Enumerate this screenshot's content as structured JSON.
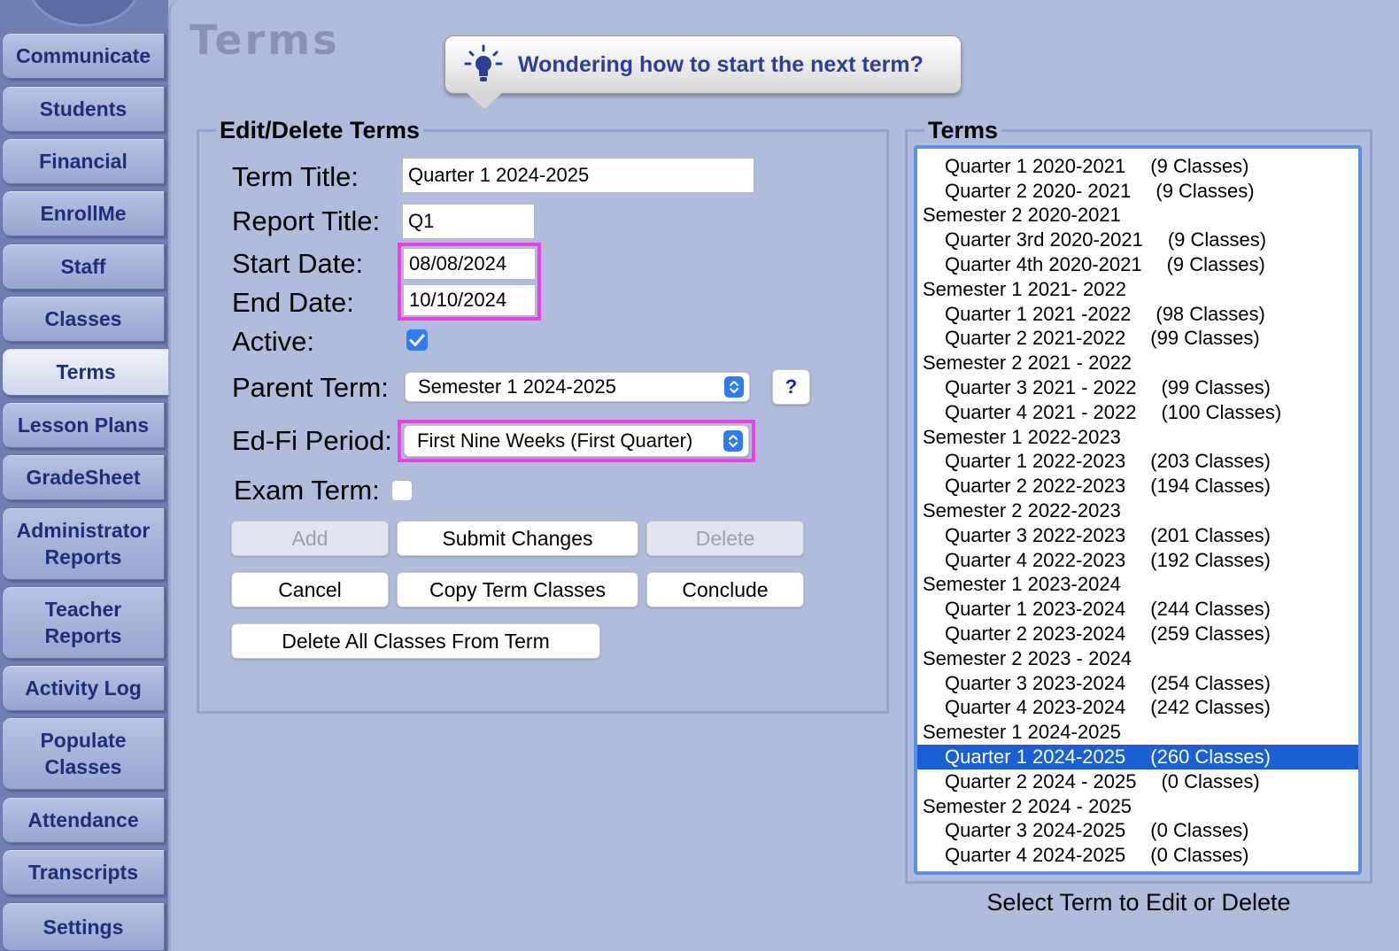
{
  "sidebar": {
    "items": [
      {
        "label": "Communicate"
      },
      {
        "label": "Students"
      },
      {
        "label": "Financial"
      },
      {
        "label": "EnrollMe"
      },
      {
        "label": "Staff"
      },
      {
        "label": "Classes"
      },
      {
        "label": "Terms",
        "active": true
      },
      {
        "label": "Lesson Plans"
      },
      {
        "label": "GradeSheet"
      },
      {
        "label": "Administrator",
        "label2": "Reports"
      },
      {
        "label": "Teacher",
        "label2": "Reports"
      },
      {
        "label": "Activity Log"
      },
      {
        "label": "Populate",
        "label2": "Classes"
      },
      {
        "label": "Attendance"
      },
      {
        "label": "Transcripts"
      },
      {
        "label": "Settings"
      }
    ]
  },
  "page": {
    "title": "Terms",
    "tip": "Wondering how to start the next term?",
    "tip_icon": "lightbulb-icon"
  },
  "edit": {
    "legend": "Edit/Delete Terms",
    "term_title_label": "Term Title:",
    "term_title_value": "Quarter 1 2024-2025",
    "report_title_label": "Report Title:",
    "report_title_value": "Q1",
    "start_date_label": "Start Date:",
    "start_date_value": "08/08/2024",
    "end_date_label": "End Date:",
    "end_date_value": "10/10/2024",
    "active_label": "Active:",
    "active_checked": true,
    "parent_term_label": "Parent Term:",
    "parent_term_value": "Semester 1 2024-2025",
    "help_label": "?",
    "edfi_label": "Ed-Fi Period:",
    "edfi_value": "First Nine Weeks (First Quarter)",
    "exam_label": "Exam Term:",
    "exam_checked": false,
    "buttons": {
      "add": "Add",
      "submit": "Submit Changes",
      "delete": "Delete",
      "cancel": "Cancel",
      "copy": "Copy Term Classes",
      "conclude": "Conclude",
      "delete_all": "Delete All Classes From Term"
    },
    "highlight_color": "#ec3fe8"
  },
  "terms": {
    "legend": "Terms",
    "caption": "Select Term to Edit or Delete",
    "selected_color": "#1a5fd6",
    "rows": [
      {
        "name": "Quarter 1 2020-2021",
        "classes": "(9 Classes)",
        "child": true
      },
      {
        "name": "Quarter 2 2020- 2021",
        "classes": "(9 Classes)",
        "child": true
      },
      {
        "name": "Semester 2 2020-2021",
        "classes": "",
        "child": false
      },
      {
        "name": "Quarter 3rd 2020-2021",
        "classes": "(9 Classes)",
        "child": true
      },
      {
        "name": "Quarter 4th 2020-2021",
        "classes": "(9 Classes)",
        "child": true
      },
      {
        "name": "Semester 1 2021- 2022",
        "classes": "",
        "child": false
      },
      {
        "name": "Quarter 1 2021 -2022",
        "classes": "(98 Classes)",
        "child": true
      },
      {
        "name": "Quarter 2 2021-2022",
        "classes": "(99 Classes)",
        "child": true
      },
      {
        "name": "Semester 2 2021 - 2022",
        "classes": "",
        "child": false
      },
      {
        "name": "Quarter 3 2021 - 2022",
        "classes": "(99 Classes)",
        "child": true
      },
      {
        "name": "Quarter 4 2021 - 2022",
        "classes": "(100 Classes)",
        "child": true
      },
      {
        "name": "Semester 1 2022-2023",
        "classes": "",
        "child": false
      },
      {
        "name": "Quarter 1 2022-2023",
        "classes": "(203 Classes)",
        "child": true
      },
      {
        "name": "Quarter 2 2022-2023",
        "classes": "(194 Classes)",
        "child": true
      },
      {
        "name": "Semester 2 2022-2023",
        "classes": "",
        "child": false
      },
      {
        "name": "Quarter 3 2022-2023",
        "classes": "(201 Classes)",
        "child": true
      },
      {
        "name": "Quarter 4 2022-2023",
        "classes": "(192 Classes)",
        "child": true
      },
      {
        "name": "Semester 1 2023-2024",
        "classes": "",
        "child": false
      },
      {
        "name": "Quarter 1 2023-2024",
        "classes": "(244 Classes)",
        "child": true
      },
      {
        "name": "Quarter 2 2023-2024",
        "classes": "(259 Classes)",
        "child": true
      },
      {
        "name": "Semester 2 2023 - 2024",
        "classes": "",
        "child": false
      },
      {
        "name": "Quarter 3 2023-2024",
        "classes": "(254 Classes)",
        "child": true
      },
      {
        "name": "Quarter 4 2023-2024",
        "classes": "(242 Classes)",
        "child": true
      },
      {
        "name": "Semester 1 2024-2025",
        "classes": "",
        "child": false
      },
      {
        "name": "Quarter 1 2024-2025",
        "classes": "(260 Classes)",
        "child": true,
        "selected": true
      },
      {
        "name": "Quarter 2 2024 - 2025",
        "classes": "(0 Classes)",
        "child": true
      },
      {
        "name": "Semester 2 2024 - 2025",
        "classes": "",
        "child": false
      },
      {
        "name": "Quarter 3 2024-2025",
        "classes": "(0 Classes)",
        "child": true
      },
      {
        "name": "Quarter 4 2024-2025",
        "classes": "(0 Classes)",
        "child": true
      }
    ]
  }
}
